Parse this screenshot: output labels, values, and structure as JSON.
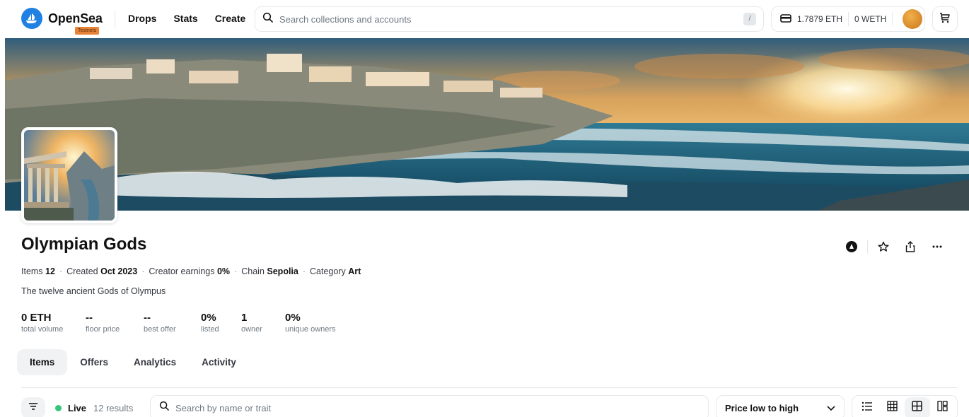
{
  "header": {
    "brand": "OpenSea",
    "badge": "Testnets",
    "nav": [
      "Drops",
      "Stats",
      "Create"
    ],
    "search_placeholder": "Search collections and accounts",
    "search_shortcut": "/",
    "wallet_eth": "1.7879 ETH",
    "wallet_weth": "0 WETH"
  },
  "collection": {
    "name": "Olympian Gods",
    "meta": {
      "items_label": "Items",
      "items_value": "12",
      "created_label": "Created",
      "created_value": "Oct 2023",
      "earnings_label": "Creator earnings",
      "earnings_value": "0%",
      "chain_label": "Chain",
      "chain_value": "Sepolia",
      "category_label": "Category",
      "category_value": "Art"
    },
    "description": "The twelve ancient Gods of Olympus",
    "stats": [
      {
        "value": "0 ETH",
        "label": "total volume"
      },
      {
        "value": "--",
        "label": "floor price"
      },
      {
        "value": "--",
        "label": "best offer"
      },
      {
        "value": "0%",
        "label": "listed"
      },
      {
        "value": "1",
        "label": "owner"
      },
      {
        "value": "0%",
        "label": "unique owners"
      }
    ]
  },
  "tabs": [
    {
      "label": "Items",
      "active": true
    },
    {
      "label": "Offers",
      "active": false
    },
    {
      "label": "Analytics",
      "active": false
    },
    {
      "label": "Activity",
      "active": false
    }
  ],
  "filters": {
    "live_label": "Live",
    "results": "12 results",
    "search_placeholder": "Search by name or trait",
    "sort_selected": "Price low to high"
  },
  "colors": {
    "brand": "#2081e2",
    "live": "#34c77b",
    "badge": "#e8833a"
  }
}
